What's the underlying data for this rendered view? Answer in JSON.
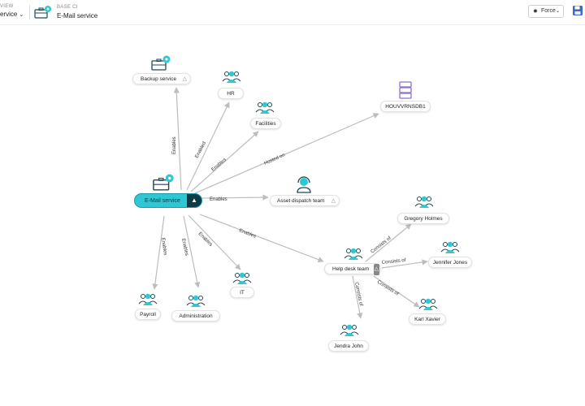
{
  "header": {
    "view_label": "VIEW",
    "view_value": "ervice",
    "base_ci_label": "BASE CI",
    "base_ci_value": "E-Mail service",
    "layout_button": "Force",
    "icons": [
      "service-briefcase-icon",
      "chevron-down-icon",
      "force-layout-icon",
      "save-icon"
    ]
  },
  "nodes": {
    "email_service": "E-Mail service",
    "backup_service": "Backup service",
    "hr": "HR",
    "facilities": "Facilities",
    "houvvrnsdb1": "HOUVVRNSDB1",
    "asset_dispatch_team": "Asset dispatch team",
    "help_desk_team": "Help desk team",
    "gregory_holmes": "Gregory Holmes",
    "jennifer_jones": "Jennifer Jones",
    "karl_xavier": "Karl Xavier",
    "jendra_john": "Jendra John",
    "it": "IT",
    "administration": "Administration",
    "payroll": "Payroll"
  },
  "edges": {
    "backup": "Enables",
    "hr": "Enabled",
    "facilities": "Enables",
    "hosted": "Hosted on",
    "asset": "Enables",
    "helpdesk": "Enables",
    "it": "Enables",
    "administration": "Enables",
    "payroll": "Enables",
    "gregory": "Consists of",
    "jennifer": "Consists of",
    "karl": "Consists of",
    "jendra": "Consists of"
  },
  "colors": {
    "accent": "#2ec7d3",
    "accent_dark": "#0e3c44",
    "database": "#8b6fcf",
    "edge": "#bdbdbd"
  }
}
